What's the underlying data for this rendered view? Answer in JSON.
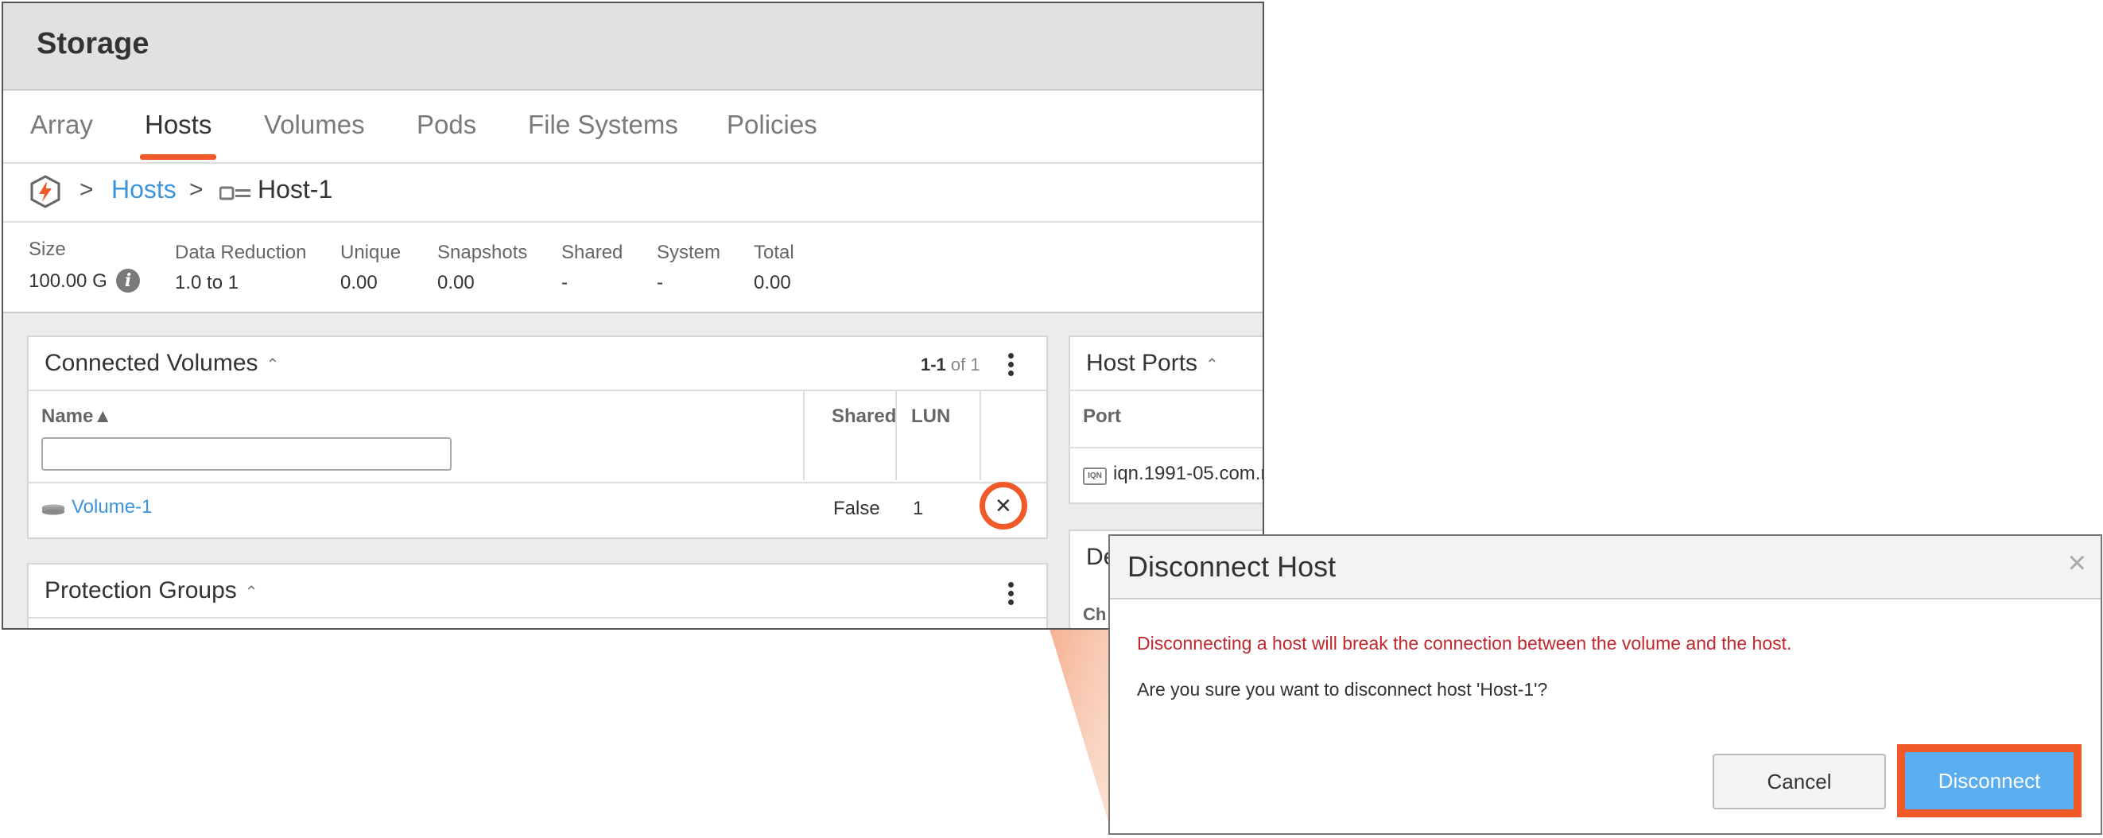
{
  "header": {
    "title": "Storage"
  },
  "tabs": [
    {
      "label": "Array"
    },
    {
      "label": "Hosts",
      "active": true
    },
    {
      "label": "Volumes"
    },
    {
      "label": "Pods"
    },
    {
      "label": "File Systems"
    },
    {
      "label": "Policies"
    }
  ],
  "breadcrumb": {
    "sep": ">",
    "hosts": "Hosts",
    "host": "Host-1"
  },
  "stats": {
    "size_label": "Size",
    "size_value": "100.00 G",
    "dr_label": "Data Reduction",
    "dr_value": "1.0 to 1",
    "unique_label": "Unique",
    "unique_value": "0.00",
    "snap_label": "Snapshots",
    "snap_value": "0.00",
    "shared_label": "Shared",
    "shared_value": "-",
    "system_label": "System",
    "system_value": "-",
    "total_label": "Total",
    "total_value": "0.00"
  },
  "connected_volumes": {
    "title": "Connected Volumes",
    "range": "1-1",
    "of_total": "of 1",
    "columns": {
      "name": "Name▲",
      "shared": "Shared",
      "lun": "LUN"
    },
    "rows": [
      {
        "name": "Volume-1",
        "shared": "False",
        "lun": "1"
      }
    ]
  },
  "protection_groups": {
    "title": "Protection Groups"
  },
  "host_ports": {
    "title": "Host Ports",
    "column": "Port",
    "badge": "IQN",
    "port": "iqn.1991-05.com.m"
  },
  "partial_card": {
    "title": "De",
    "col": "Ch"
  },
  "dialog": {
    "title": "Disconnect Host",
    "close": "×",
    "warning": "Disconnecting a host will break the connection between the volume and the host.",
    "question": "Are you sure you want to disconnect host 'Host-1'?",
    "cancel": "Cancel",
    "confirm": "Disconnect"
  },
  "colors": {
    "accent": "#f05a28",
    "link": "#3b95de",
    "primary_button": "#5aaef0",
    "warning": "#c1272d"
  }
}
